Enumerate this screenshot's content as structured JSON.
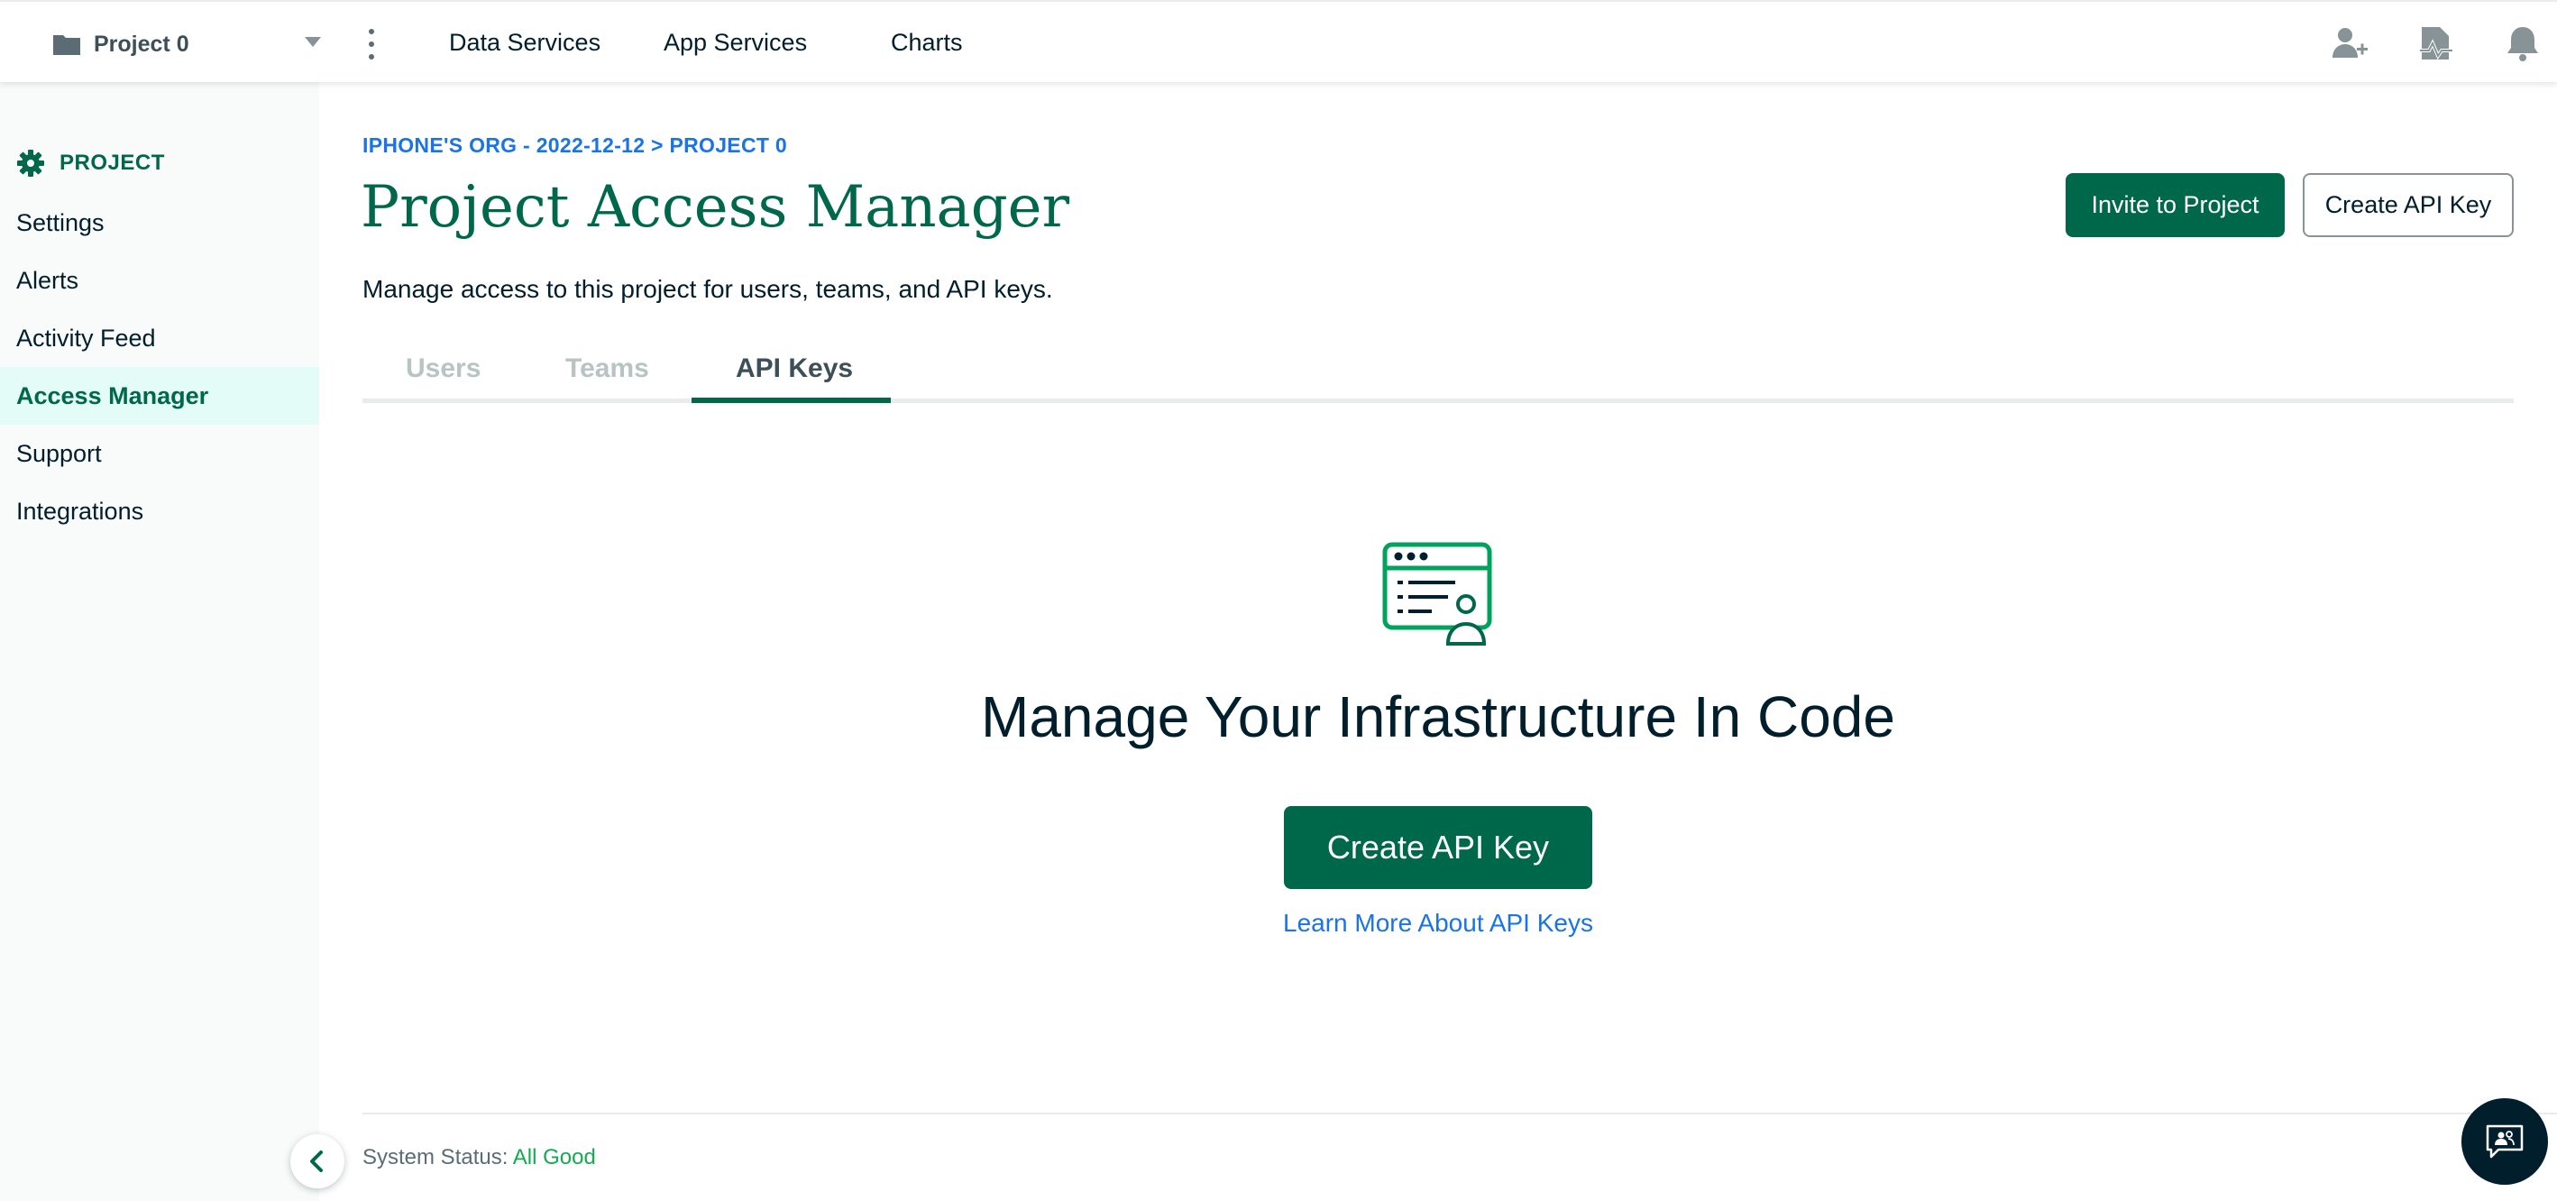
{
  "topbar": {
    "project_name": "Project 0",
    "nav": [
      "Data Services",
      "App Services",
      "Charts"
    ],
    "icons": [
      "invite-user-icon",
      "activity-icon",
      "bell-icon"
    ]
  },
  "sidebar": {
    "header": "PROJECT",
    "items": [
      {
        "label": "Settings"
      },
      {
        "label": "Alerts"
      },
      {
        "label": "Activity Feed"
      },
      {
        "label": "Access Manager",
        "active": true
      },
      {
        "label": "Support"
      },
      {
        "label": "Integrations"
      }
    ]
  },
  "main": {
    "breadcrumb": "IPHONE'S ORG - 2022-12-12 > PROJECT 0",
    "title": "Project Access Manager",
    "description": "Manage access to this project for users, teams, and API keys.",
    "invite_button": "Invite to Project",
    "create_key_button": "Create API Key",
    "tabs": [
      {
        "label": "Users",
        "active": false
      },
      {
        "label": "Teams",
        "active": false
      },
      {
        "label": "API Keys",
        "active": true
      }
    ],
    "empty_state": {
      "title": "Manage Your Infrastructure In Code",
      "button": "Create API Key",
      "link": "Learn More About API Keys"
    }
  },
  "footer": {
    "status_label": "System Status:",
    "status_value": "All Good"
  },
  "colors": {
    "brand_green": "#00684a",
    "link_blue": "#1a73e8",
    "status_green": "#13aa52",
    "dark": "#001e2b"
  }
}
